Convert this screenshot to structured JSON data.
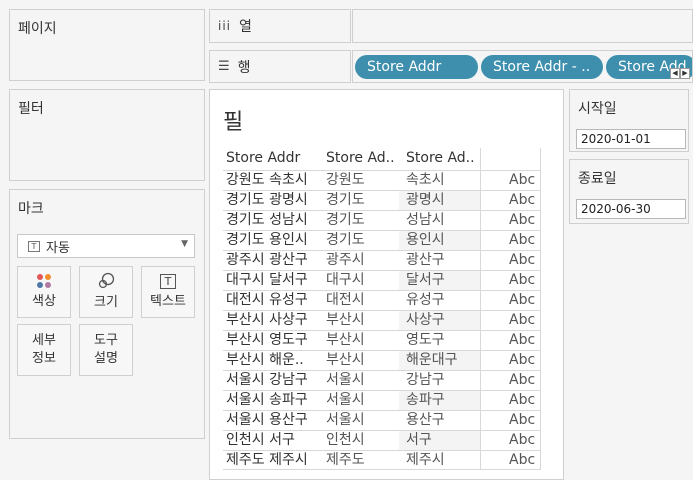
{
  "pages_card": {
    "title": "페이지"
  },
  "filters_card": {
    "title": "필터"
  },
  "marks_card": {
    "title": "마크",
    "mark_type": "자동",
    "buttons": [
      {
        "label": "색상",
        "icon": "color-dots-icon"
      },
      {
        "label": "크기",
        "icon": "size-circles-icon"
      },
      {
        "label": "텍스트",
        "icon": "text-box-icon"
      },
      {
        "label": "세부\n정보",
        "icon": ""
      },
      {
        "label": "도구\n설명",
        "icon": ""
      }
    ]
  },
  "columns_shelf": {
    "label": "열",
    "icon": "columns-icon"
  },
  "rows_shelf": {
    "label": "행",
    "icon": "rows-icon",
    "pills": [
      "Store Addr",
      "Store Addr - ..",
      "Store Add"
    ]
  },
  "view": {
    "title": "필",
    "headers": [
      "Store Addr",
      "Store Ad..",
      "Store Ad.."
    ],
    "rows": [
      [
        "강원도 속초시",
        "강원도",
        "속초시",
        "Abc"
      ],
      [
        "경기도 광명시",
        "경기도",
        "광명시",
        "Abc"
      ],
      [
        "경기도 성남시",
        "경기도",
        "성남시",
        "Abc"
      ],
      [
        "경기도 용인시",
        "경기도",
        "용인시",
        "Abc"
      ],
      [
        "광주시 광산구",
        "광주시",
        "광산구",
        "Abc"
      ],
      [
        "대구시 달서구",
        "대구시",
        "달서구",
        "Abc"
      ],
      [
        "대전시 유성구",
        "대전시",
        "유성구",
        "Abc"
      ],
      [
        "부산시 사상구",
        "부산시",
        "사상구",
        "Abc"
      ],
      [
        "부산시 영도구",
        "부산시",
        "영도구",
        "Abc"
      ],
      [
        "부산시 해운..",
        "부산시",
        "해운대구",
        "Abc"
      ],
      [
        "서울시 강남구",
        "서울시",
        "강남구",
        "Abc"
      ],
      [
        "서울시 송파구",
        "서울시",
        "송파구",
        "Abc"
      ],
      [
        "서울시 용산구",
        "서울시",
        "용산구",
        "Abc"
      ],
      [
        "인천시 서구",
        "인천시",
        "서구",
        "Abc"
      ],
      [
        "제주도 제주시",
        "제주도",
        "제주시",
        "Abc"
      ]
    ]
  },
  "start_date": {
    "title": "시작일",
    "value": "2020-01-01"
  },
  "end_date": {
    "title": "종료일",
    "value": "2020-06-30"
  }
}
